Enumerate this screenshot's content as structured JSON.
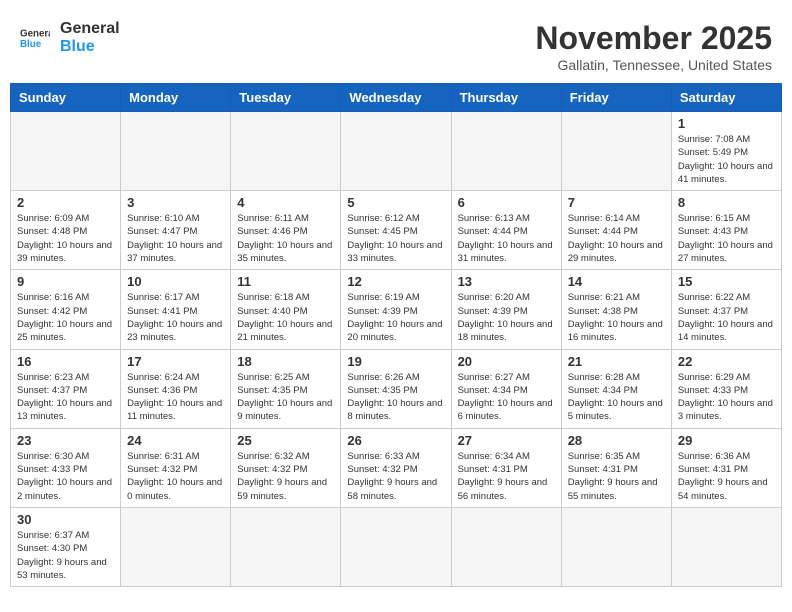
{
  "header": {
    "logo_general": "General",
    "logo_blue": "Blue",
    "month_title": "November 2025",
    "location": "Gallatin, Tennessee, United States"
  },
  "weekdays": [
    "Sunday",
    "Monday",
    "Tuesday",
    "Wednesday",
    "Thursday",
    "Friday",
    "Saturday"
  ],
  "weeks": [
    [
      {
        "day": "",
        "info": ""
      },
      {
        "day": "",
        "info": ""
      },
      {
        "day": "",
        "info": ""
      },
      {
        "day": "",
        "info": ""
      },
      {
        "day": "",
        "info": ""
      },
      {
        "day": "",
        "info": ""
      },
      {
        "day": "1",
        "info": "Sunrise: 7:08 AM\nSunset: 5:49 PM\nDaylight: 10 hours and 41 minutes."
      }
    ],
    [
      {
        "day": "2",
        "info": "Sunrise: 6:09 AM\nSunset: 4:48 PM\nDaylight: 10 hours and 39 minutes."
      },
      {
        "day": "3",
        "info": "Sunrise: 6:10 AM\nSunset: 4:47 PM\nDaylight: 10 hours and 37 minutes."
      },
      {
        "day": "4",
        "info": "Sunrise: 6:11 AM\nSunset: 4:46 PM\nDaylight: 10 hours and 35 minutes."
      },
      {
        "day": "5",
        "info": "Sunrise: 6:12 AM\nSunset: 4:45 PM\nDaylight: 10 hours and 33 minutes."
      },
      {
        "day": "6",
        "info": "Sunrise: 6:13 AM\nSunset: 4:44 PM\nDaylight: 10 hours and 31 minutes."
      },
      {
        "day": "7",
        "info": "Sunrise: 6:14 AM\nSunset: 4:44 PM\nDaylight: 10 hours and 29 minutes."
      },
      {
        "day": "8",
        "info": "Sunrise: 6:15 AM\nSunset: 4:43 PM\nDaylight: 10 hours and 27 minutes."
      }
    ],
    [
      {
        "day": "9",
        "info": "Sunrise: 6:16 AM\nSunset: 4:42 PM\nDaylight: 10 hours and 25 minutes."
      },
      {
        "day": "10",
        "info": "Sunrise: 6:17 AM\nSunset: 4:41 PM\nDaylight: 10 hours and 23 minutes."
      },
      {
        "day": "11",
        "info": "Sunrise: 6:18 AM\nSunset: 4:40 PM\nDaylight: 10 hours and 21 minutes."
      },
      {
        "day": "12",
        "info": "Sunrise: 6:19 AM\nSunset: 4:39 PM\nDaylight: 10 hours and 20 minutes."
      },
      {
        "day": "13",
        "info": "Sunrise: 6:20 AM\nSunset: 4:39 PM\nDaylight: 10 hours and 18 minutes."
      },
      {
        "day": "14",
        "info": "Sunrise: 6:21 AM\nSunset: 4:38 PM\nDaylight: 10 hours and 16 minutes."
      },
      {
        "day": "15",
        "info": "Sunrise: 6:22 AM\nSunset: 4:37 PM\nDaylight: 10 hours and 14 minutes."
      }
    ],
    [
      {
        "day": "16",
        "info": "Sunrise: 6:23 AM\nSunset: 4:37 PM\nDaylight: 10 hours and 13 minutes."
      },
      {
        "day": "17",
        "info": "Sunrise: 6:24 AM\nSunset: 4:36 PM\nDaylight: 10 hours and 11 minutes."
      },
      {
        "day": "18",
        "info": "Sunrise: 6:25 AM\nSunset: 4:35 PM\nDaylight: 10 hours and 9 minutes."
      },
      {
        "day": "19",
        "info": "Sunrise: 6:26 AM\nSunset: 4:35 PM\nDaylight: 10 hours and 8 minutes."
      },
      {
        "day": "20",
        "info": "Sunrise: 6:27 AM\nSunset: 4:34 PM\nDaylight: 10 hours and 6 minutes."
      },
      {
        "day": "21",
        "info": "Sunrise: 6:28 AM\nSunset: 4:34 PM\nDaylight: 10 hours and 5 minutes."
      },
      {
        "day": "22",
        "info": "Sunrise: 6:29 AM\nSunset: 4:33 PM\nDaylight: 10 hours and 3 minutes."
      }
    ],
    [
      {
        "day": "23",
        "info": "Sunrise: 6:30 AM\nSunset: 4:33 PM\nDaylight: 10 hours and 2 minutes."
      },
      {
        "day": "24",
        "info": "Sunrise: 6:31 AM\nSunset: 4:32 PM\nDaylight: 10 hours and 0 minutes."
      },
      {
        "day": "25",
        "info": "Sunrise: 6:32 AM\nSunset: 4:32 PM\nDaylight: 9 hours and 59 minutes."
      },
      {
        "day": "26",
        "info": "Sunrise: 6:33 AM\nSunset: 4:32 PM\nDaylight: 9 hours and 58 minutes."
      },
      {
        "day": "27",
        "info": "Sunrise: 6:34 AM\nSunset: 4:31 PM\nDaylight: 9 hours and 56 minutes."
      },
      {
        "day": "28",
        "info": "Sunrise: 6:35 AM\nSunset: 4:31 PM\nDaylight: 9 hours and 55 minutes."
      },
      {
        "day": "29",
        "info": "Sunrise: 6:36 AM\nSunset: 4:31 PM\nDaylight: 9 hours and 54 minutes."
      }
    ],
    [
      {
        "day": "30",
        "info": "Sunrise: 6:37 AM\nSunset: 4:30 PM\nDaylight: 9 hours and 53 minutes."
      },
      {
        "day": "",
        "info": ""
      },
      {
        "day": "",
        "info": ""
      },
      {
        "day": "",
        "info": ""
      },
      {
        "day": "",
        "info": ""
      },
      {
        "day": "",
        "info": ""
      },
      {
        "day": "",
        "info": ""
      }
    ]
  ]
}
